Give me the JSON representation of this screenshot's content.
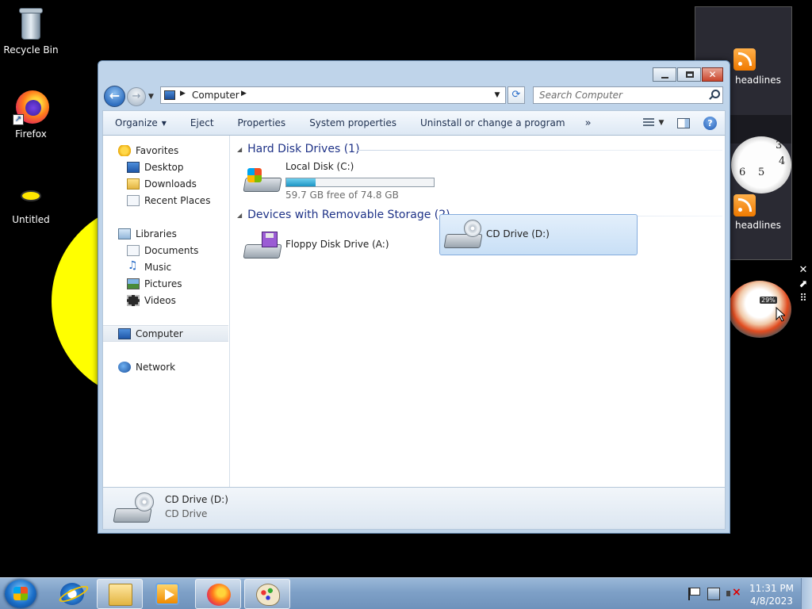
{
  "desktop": {
    "icons": [
      {
        "label": "Recycle Bin",
        "icon": "recycle-bin-icon"
      },
      {
        "label": "Firefox",
        "icon": "firefox-icon"
      },
      {
        "label": "Untitled",
        "icon": "ellipse-drawing-icon"
      }
    ],
    "gadgets": {
      "feed_label_1": "headlines",
      "feed_label_2": "headlines",
      "clock_numbers": [
        "3",
        "4",
        "5",
        "6"
      ],
      "meter_badge": "29%"
    }
  },
  "window": {
    "address": {
      "icon": "computer-icon",
      "crumb": "Computer"
    },
    "search": {
      "placeholder": "Search Computer"
    },
    "commands": {
      "organize": "Organize",
      "eject": "Eject",
      "properties": "Properties",
      "system_properties": "System properties",
      "uninstall": "Uninstall or change a program",
      "more": "»"
    },
    "nav": {
      "favorites": "Favorites",
      "desktop": "Desktop",
      "downloads": "Downloads",
      "recent": "Recent Places",
      "libraries": "Libraries",
      "documents": "Documents",
      "music": "Music",
      "pictures": "Pictures",
      "videos": "Videos",
      "computer": "Computer",
      "network": "Network"
    },
    "groups": {
      "hdd": "Hard Disk Drives (1)",
      "removable": "Devices with Removable Storage (2)"
    },
    "drives": {
      "c": {
        "name": "Local Disk (C:)",
        "free_text": "59.7 GB free of 74.8 GB",
        "used_fraction": 0.2
      },
      "a": {
        "name": "Floppy Disk Drive (A:)"
      },
      "d": {
        "name": "CD Drive (D:)",
        "selected": true
      }
    },
    "details": {
      "name": "CD Drive (D:)",
      "type": "CD Drive"
    }
  },
  "taskbar": {
    "items": [
      "start",
      "internet-explorer",
      "windows-explorer",
      "media-player",
      "firefox",
      "paint"
    ],
    "active": "windows-explorer",
    "time": "11:31 PM",
    "date": "4/8/2023"
  }
}
